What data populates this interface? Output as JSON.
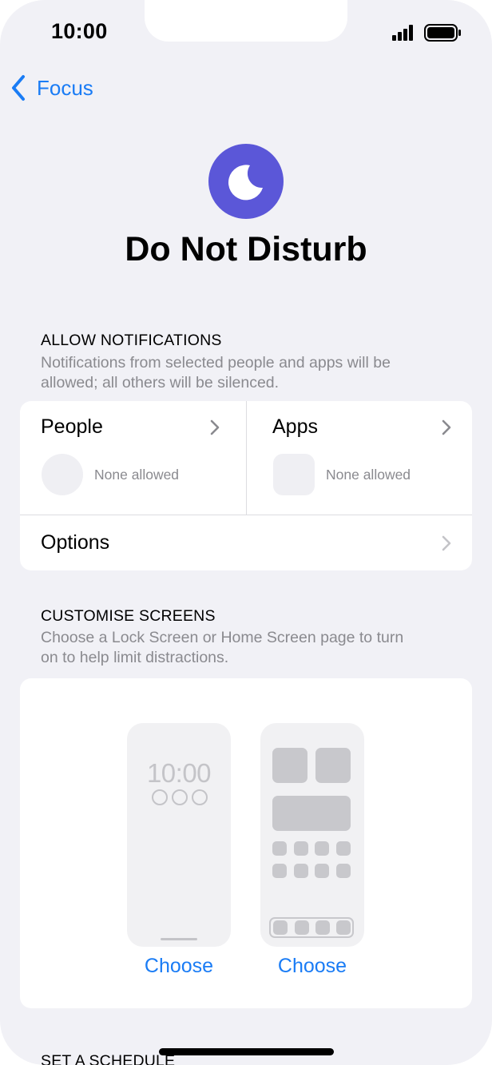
{
  "status_bar": {
    "time": "10:00",
    "signal_icon": "cellular-signal-icon",
    "battery_icon": "battery-icon"
  },
  "nav": {
    "back_label": "Focus",
    "back_icon": "chevron-left-icon"
  },
  "focus_icon": "moon-icon",
  "title": "Do Not Disturb",
  "allow_notifications": {
    "header": "ALLOW NOTIFICATIONS",
    "description_line1": "Notifications from selected people and apps will be",
    "description_line2": "allowed; all others will be silenced.",
    "people": {
      "label": "People",
      "status": "None allowed"
    },
    "apps": {
      "label": "Apps",
      "status": "None allowed"
    },
    "options": {
      "label": "Options"
    }
  },
  "customise_screens": {
    "header": "CUSTOMISE SCREENS",
    "description_line1": "Choose a Lock Screen or Home Screen page to turn",
    "description_line2": "on to help limit distractions.",
    "lock_screen": {
      "time": "10:00",
      "button_label": "Choose"
    },
    "home_screen": {
      "button_label": "Choose"
    }
  },
  "set_schedule": {
    "header": "SET A SCHEDULE"
  },
  "colors": {
    "accent": "#1a7cf5",
    "focus_purple": "#5b57d8",
    "background": "#f1f1f6",
    "secondary_text": "#8a8a8f"
  }
}
